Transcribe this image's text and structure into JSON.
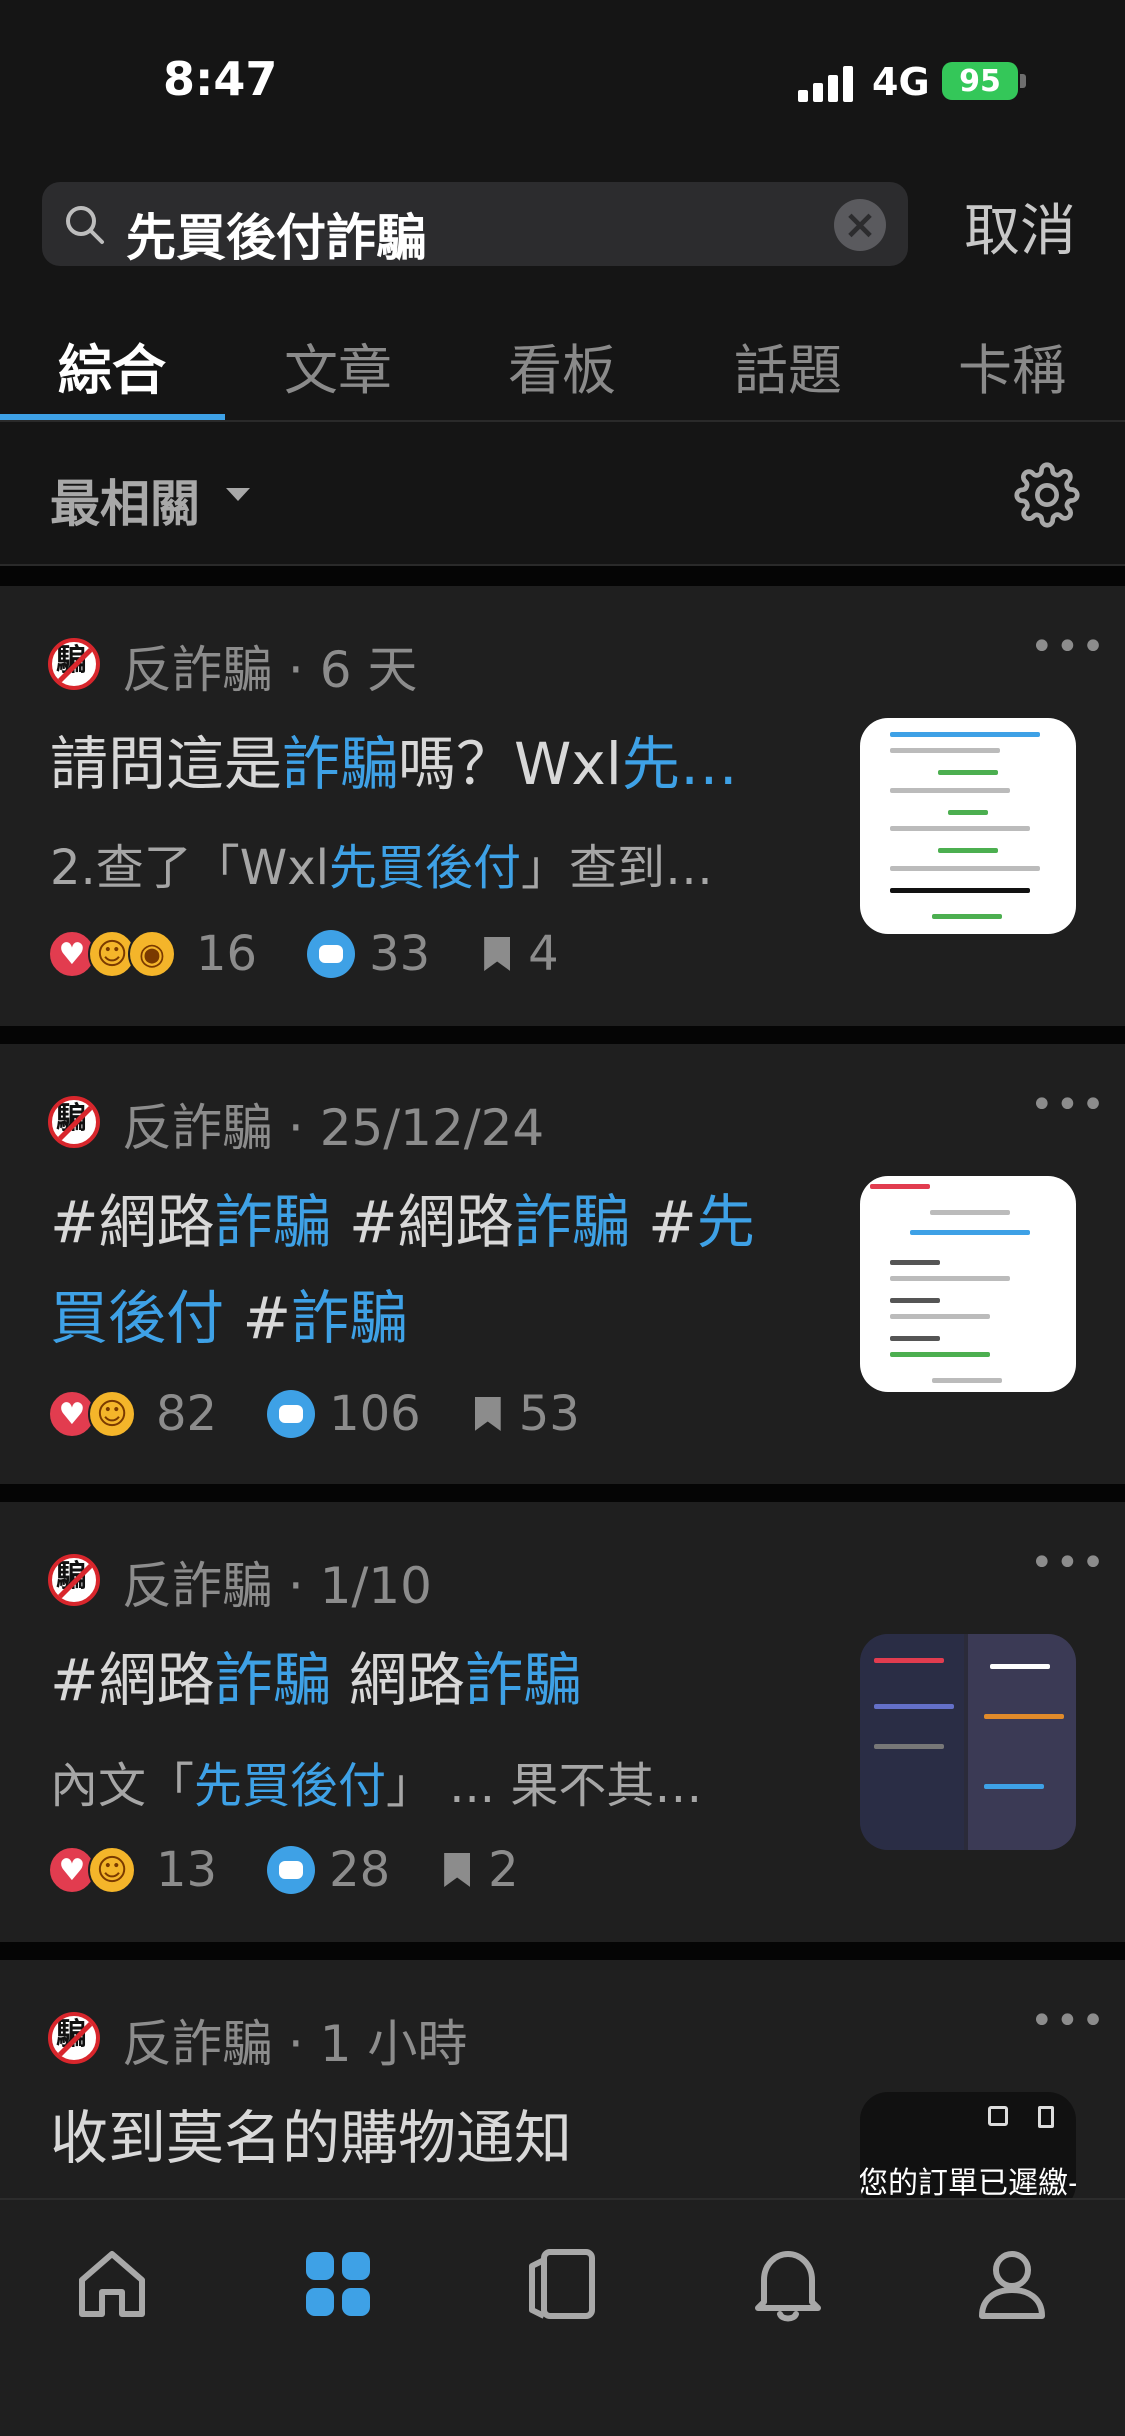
{
  "status_bar": {
    "time": "8:47",
    "network": "4G",
    "battery": "95"
  },
  "search": {
    "query": "先買後付詐騙",
    "cancel_label": "取消"
  },
  "tabs": [
    {
      "label": "綜合",
      "active": true
    },
    {
      "label": "文章",
      "active": false
    },
    {
      "label": "看板",
      "active": false
    },
    {
      "label": "話題",
      "active": false
    },
    {
      "label": "卡稱",
      "active": false
    }
  ],
  "sort": {
    "label": "最相關"
  },
  "posts": [
    {
      "forum": "反詐騙",
      "time": "6 天",
      "title_parts": [
        "請問這是",
        "詐騙",
        "嗎？Wxl",
        "先…"
      ],
      "excerpt_parts": [
        "2.查了「Wxl",
        "先買後付",
        "」查到…"
      ],
      "reactions": 16,
      "comments": 33,
      "saves": 4
    },
    {
      "forum": "反詐騙",
      "time": "25/12/24",
      "title_parts": [
        "#網路",
        "詐騙",
        " #網路",
        "詐騙",
        " #",
        "先買後付",
        " #",
        "詐騙"
      ],
      "reactions": 82,
      "comments": 106,
      "saves": 53
    },
    {
      "forum": "反詐騙",
      "time": "1/10",
      "title_parts": [
        "#網路",
        "詐騙",
        " 網路",
        "詐騙"
      ],
      "excerpt_parts": [
        "內文「",
        "先買後付",
        "」 ... 果不其…"
      ],
      "reactions": 13,
      "comments": 28,
      "saves": 2
    },
    {
      "forum": "反詐騙",
      "time": "1 小時",
      "title": "收到莫名的購物通知",
      "thumb_text": "您的訂單已遲繳-"
    }
  ],
  "avatar_glyph": "騙",
  "colors": {
    "accent": "#3ea1e6",
    "background": "#1f1f1f",
    "battery": "#34c759"
  },
  "nav": [
    "home-icon",
    "grid-icon",
    "cards-icon",
    "bell-icon",
    "profile-icon"
  ]
}
